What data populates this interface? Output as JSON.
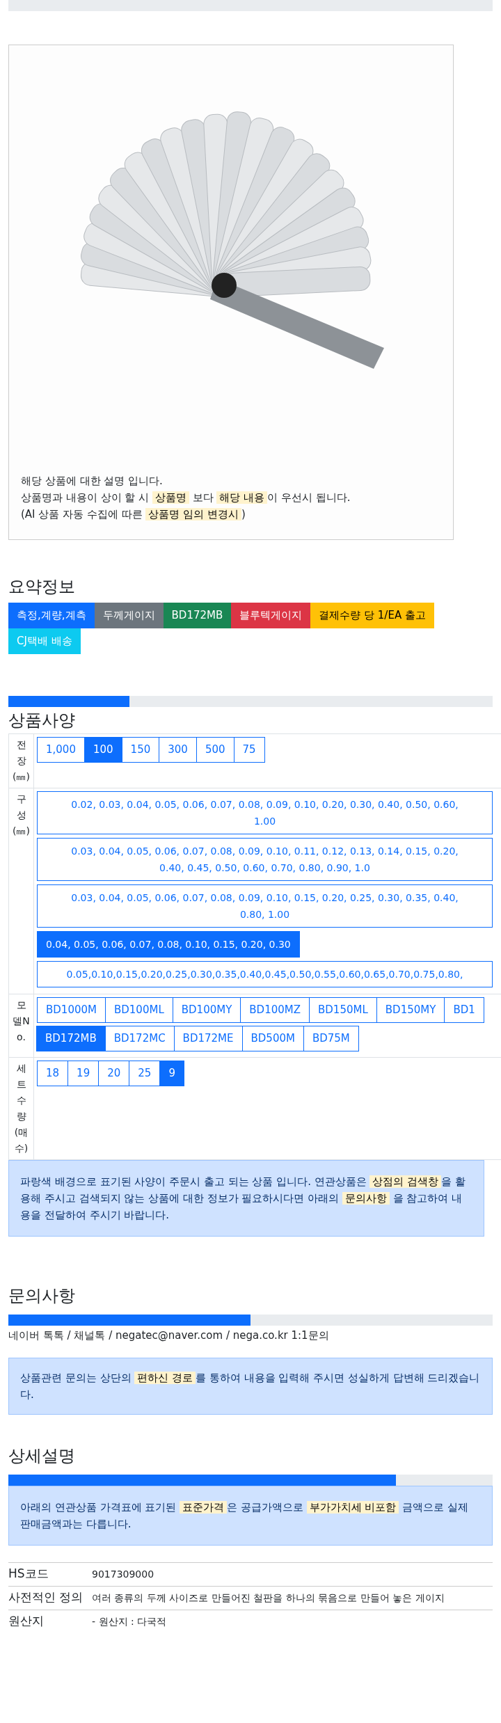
{
  "product_card": {
    "caption_lines": [
      [
        {
          "text": "해당 상품에 대한 설명 입니다.",
          "highlight": false
        }
      ],
      [
        {
          "text": "상품명과 내용이 상이 할 시 ",
          "highlight": false
        },
        {
          "text": "상품명",
          "highlight": true
        },
        {
          "text": " 보다 ",
          "highlight": false
        },
        {
          "text": "해당 내용",
          "highlight": true
        },
        {
          "text": "이 우선시 됩니다.",
          "highlight": false
        }
      ],
      [
        {
          "text": "(AI 상품 자동 수집에 따른 ",
          "highlight": false
        },
        {
          "text": "상품명 임의 변경시",
          "highlight": true
        },
        {
          "text": ")",
          "highlight": false
        }
      ]
    ]
  },
  "summary": {
    "title": "요약정보",
    "tags": [
      {
        "label": "측정,계량,계측",
        "color": "#0d6efd"
      },
      {
        "label": "두께게이지",
        "color": "#6c757d"
      },
      {
        "label": "BD172MB",
        "color": "#198754"
      },
      {
        "label": "블루텍게이지",
        "color": "#dc3545"
      },
      {
        "label": "결제수량 당 1/EA 출고",
        "color": "#ffc107"
      },
      {
        "label": "CJ택배 배송",
        "color": "#0dcaf0"
      }
    ]
  },
  "specs": {
    "level": 0.25,
    "title": "상품사양",
    "rows": [
      {
        "header": "전장(㎜)",
        "kind": "inline",
        "options": [
          {
            "label": "1,000",
            "selected": false
          },
          {
            "label": "100",
            "selected": true
          },
          {
            "label": "150",
            "selected": false
          },
          {
            "label": "300",
            "selected": false
          },
          {
            "label": "500",
            "selected": false
          },
          {
            "label": "75",
            "selected": false
          }
        ]
      },
      {
        "header": "구성(㎜)",
        "kind": "stacked",
        "options": [
          {
            "lines": [
              "0.02, 0.03, 0.04, 0.05, 0.06, 0.07, 0.08, 0.09, 0.10, 0.20, 0.30, 0.40, 0.50, 0.60,",
              "1.00"
            ],
            "selected": false
          },
          {
            "lines": [
              "0.03, 0.04, 0.05, 0.06, 0.07, 0.08, 0.09, 0.10, 0.11, 0.12, 0.13, 0.14, 0.15, 0.20,",
              "0.40, 0.45, 0.50, 0.60, 0.70, 0.80, 0.90, 1.0"
            ],
            "selected": false
          },
          {
            "lines": [
              "0.03, 0.04, 0.05, 0.06, 0.07, 0.08, 0.09, 0.10, 0.15, 0.20, 0.25, 0.30, 0.35, 0.40,",
              "0.80, 1.00"
            ],
            "selected": false
          },
          {
            "lines": [
              "0.04, 0.05, 0.06, 0.07, 0.08, 0.10, 0.15, 0.20, 0.30"
            ],
            "selected": true
          },
          {
            "lines": [
              "0.05,0.10,0.15,0.20,0.25,0.30,0.35,0.40,0.45,0.50,0.55,0.60,0.65,0.70,0.75,0.80,"
            ],
            "selected": false
          }
        ]
      },
      {
        "header": "모델No.",
        "kind": "inline",
        "options": [
          {
            "label": "BD1000M",
            "selected": false
          },
          {
            "label": "BD100ML",
            "selected": false
          },
          {
            "label": "BD100MY",
            "selected": false
          },
          {
            "label": "BD100MZ",
            "selected": false
          },
          {
            "label": "BD150ML",
            "selected": false
          },
          {
            "label": "BD150MY",
            "selected": false
          },
          {
            "label": "BD1",
            "selected": false
          },
          {
            "label": "BD172MB",
            "selected": true
          },
          {
            "label": "BD172MC",
            "selected": false
          },
          {
            "label": "BD172ME",
            "selected": false
          },
          {
            "label": "BD500M",
            "selected": false
          },
          {
            "label": "BD75M",
            "selected": false
          }
        ]
      },
      {
        "header": "세트수량(매수)",
        "kind": "inline",
        "options": [
          {
            "label": "18",
            "selected": false
          },
          {
            "label": "19",
            "selected": false
          },
          {
            "label": "20",
            "selected": false
          },
          {
            "label": "25",
            "selected": false
          },
          {
            "label": "9",
            "selected": true
          }
        ]
      }
    ],
    "notice": [
      {
        "text": "파랑색 배경으로 표기된 사양이 주문시 출고 되는 상품 입니다. 연관상품은 ",
        "highlight": false
      },
      {
        "text": "상점의 검색창",
        "highlight": true
      },
      {
        "text": "을 활용해 주시고 검색되지 않는 상품에 대한 정보가 필요하시다면 아래의 ",
        "highlight": false
      },
      {
        "text": "문의사항",
        "highlight": true
      },
      {
        "text": " 을 참고하여 내용을 전달하여 주시기 바랍니다.",
        "highlight": false
      }
    ]
  },
  "inquiry": {
    "title": "문의사항",
    "level": 0.5,
    "contacts": "네이버 톡톡 / 채널톡 / negatec@naver.com / nega.co.kr 1:1문의",
    "notice": [
      {
        "text": "상품관련 문의는 상단의 ",
        "highlight": false
      },
      {
        "text": "편하신 경로",
        "highlight": true
      },
      {
        "text": "를 통하여 내용을 입력해 주시면 성실하게 답변해 드리겠습니다.",
        "highlight": false
      }
    ]
  },
  "detail": {
    "title": "상세설명",
    "level": 0.8,
    "notice": [
      {
        "text": "아래의 연관상품 가격표에 표기된 ",
        "highlight": false
      },
      {
        "text": "표준가격",
        "highlight": true
      },
      {
        "text": "은 공급가액으로 ",
        "highlight": false
      },
      {
        "text": "부가가치세 비포함",
        "highlight": true
      },
      {
        "text": " 금액으로 실제 판매금액과는 다릅니다.",
        "highlight": false
      }
    ],
    "rows": [
      {
        "label": "HS코드",
        "value": "9017309000"
      },
      {
        "label": "사전적인 정의",
        "value": "여러 종류의 두께 사이즈로 만들어진 철판을 하나의 묶음으로 만들어 놓은 게이지"
      },
      {
        "label": "원산지",
        "value": "- 원산지 : 다국적"
      }
    ]
  }
}
